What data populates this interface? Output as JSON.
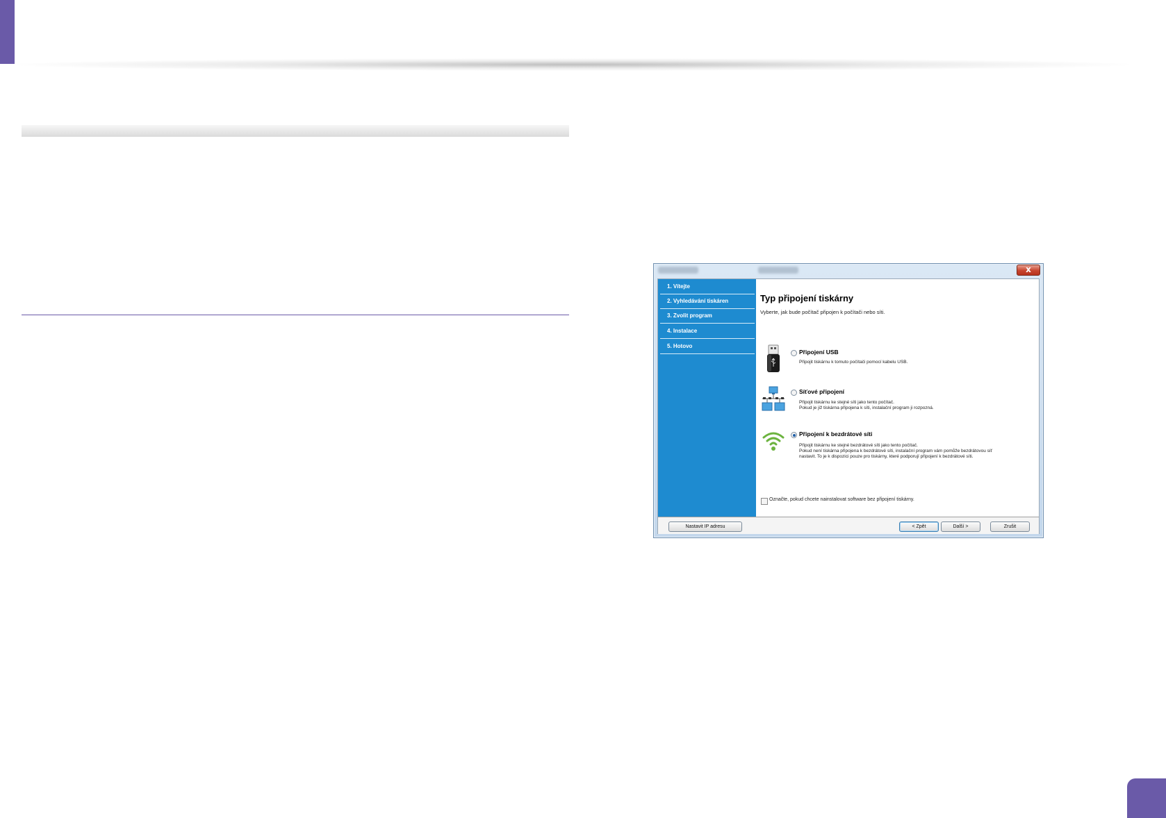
{
  "window": {
    "title_text": "",
    "close_label": "x"
  },
  "sidebar": {
    "items": [
      {
        "label": "1. Vítejte"
      },
      {
        "label": "2. Vyhledávání tiskáren"
      },
      {
        "label": "3. Zvolit program"
      },
      {
        "label": "4. Instalace"
      },
      {
        "label": "5. Hotovo"
      }
    ]
  },
  "content": {
    "title": "Typ připojení tiskárny",
    "subtitle": "Vyberte, jak bude počítač připojen k počítači nebo síti.",
    "options": [
      {
        "label": "Připojení USB",
        "selected": false,
        "icon": "usb-icon",
        "desc": [
          "Připojit tiskárnu k tomuto počítači pomocí kabelu USB."
        ]
      },
      {
        "label": "Síťové připojení",
        "selected": false,
        "icon": "network-icon",
        "desc": [
          "Připojit tiskárnu ke stejné síti jako tento počítač.",
          "Pokud je již tiskárna připojena k síti, instalační program ji rozpozná."
        ]
      },
      {
        "label": "Připojení k bezdrátové síti",
        "selected": true,
        "icon": "wifi-icon",
        "desc": [
          "Připojit tiskárnu ke stejné bezdrátové síti jako tento počítač.",
          "Pokud není tiskárna připojena k bezdrátové síti, instalační program vám pomůže bezdrátovou síť",
          "nastavit. To je k dispozici pouze pro tiskárny, které podporují připojení k bezdrátové síti."
        ]
      }
    ],
    "checkbox_label": "Označte, pokud chcete nainstalovat software bez připojení tiskárny.",
    "checkbox_checked": false
  },
  "footer": {
    "set_ip_label": "Nastavit IP adresu",
    "back_label": "< Zpět",
    "next_label": "Další >",
    "cancel_label": "Zrušit"
  },
  "colors": {
    "accent": "#6a5aa8",
    "sidebar": "#1e8bd0",
    "wifi": "#6cb33f"
  }
}
